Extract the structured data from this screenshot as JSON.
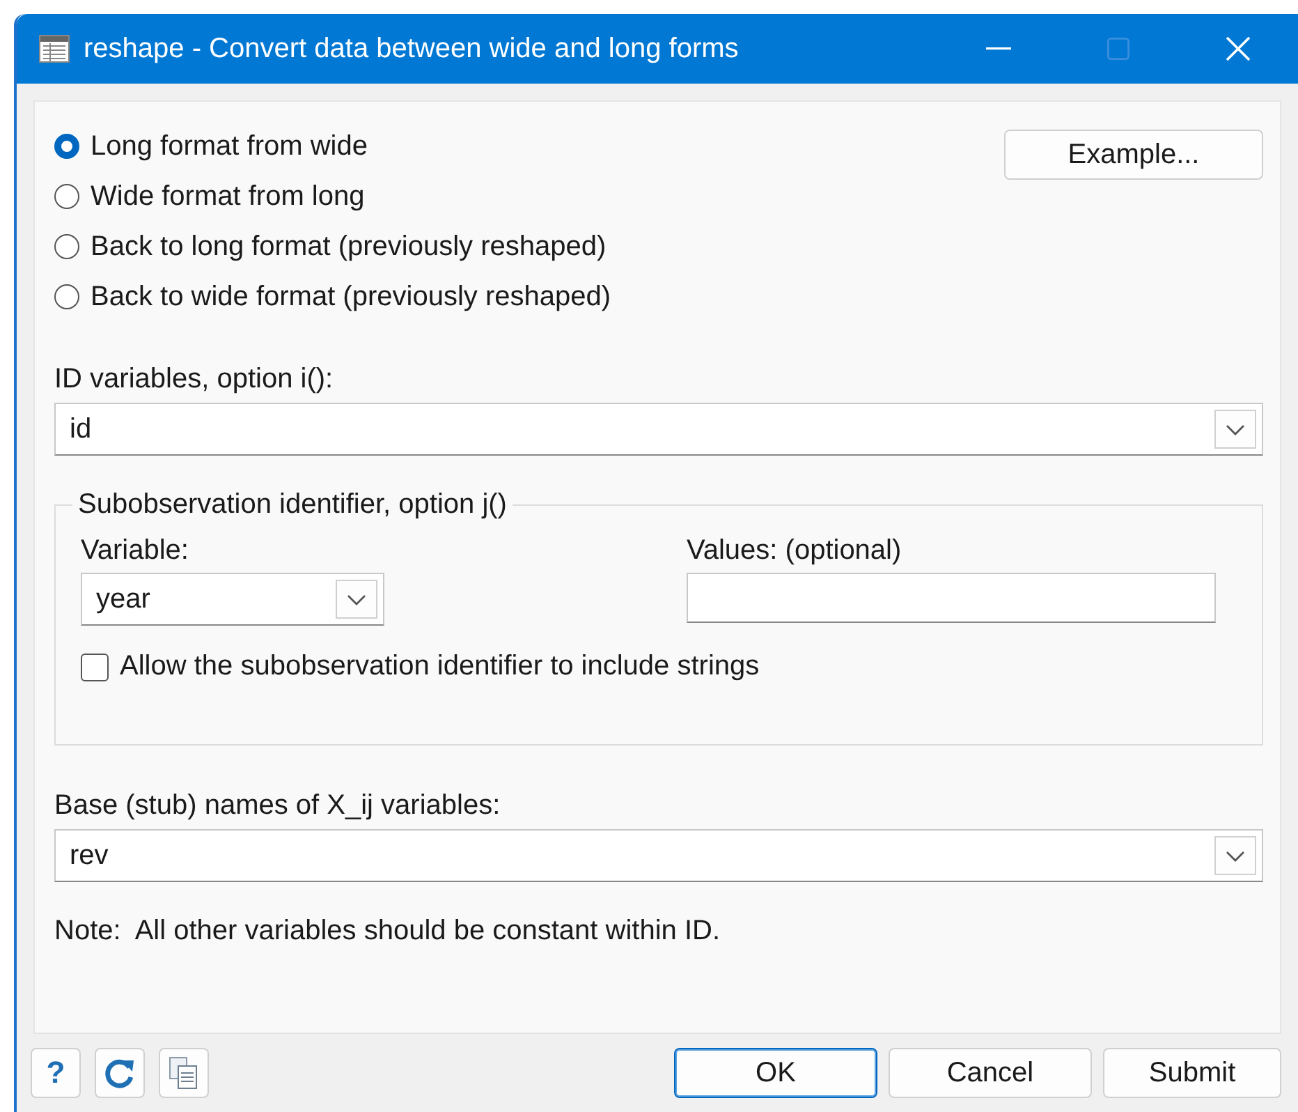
{
  "window": {
    "title": "reshape - Convert data between wide and long forms",
    "controls": [
      {
        "kind": "minimize",
        "disabled": false
      },
      {
        "kind": "maximize",
        "disabled": true
      },
      {
        "kind": "close",
        "disabled": false
      }
    ]
  },
  "modes": [
    {
      "label": "Long format from wide",
      "selected": true
    },
    {
      "label": "Wide format from long",
      "selected": false
    },
    {
      "label": "Back to long format (previously reshaped)",
      "selected": false
    },
    {
      "label": "Back to wide format (previously reshaped)",
      "selected": false
    }
  ],
  "example_button": "Example...",
  "id_variables": {
    "label": "ID variables, option i():",
    "value": "id"
  },
  "subobservation": {
    "legend": "Subobservation identifier, option j()",
    "variable": {
      "label": "Variable:",
      "value": "year"
    },
    "values": {
      "label": "Values: (optional)"
    },
    "allow_strings": {
      "label": "Allow the subobservation identifier to include strings",
      "checked": false
    }
  },
  "stub_names": {
    "label": "Base (stub) names of X_ij variables:",
    "value": "rev"
  },
  "note": "Note:  All other variables should be constant within ID.",
  "footer": {
    "tools": [
      {
        "kind": "help",
        "label": "?"
      },
      {
        "kind": "reset"
      },
      {
        "kind": "copy"
      }
    ],
    "buttons": [
      {
        "label": "OK",
        "default": true
      },
      {
        "label": "Cancel",
        "default": false
      },
      {
        "label": "Submit",
        "default": false
      }
    ]
  }
}
